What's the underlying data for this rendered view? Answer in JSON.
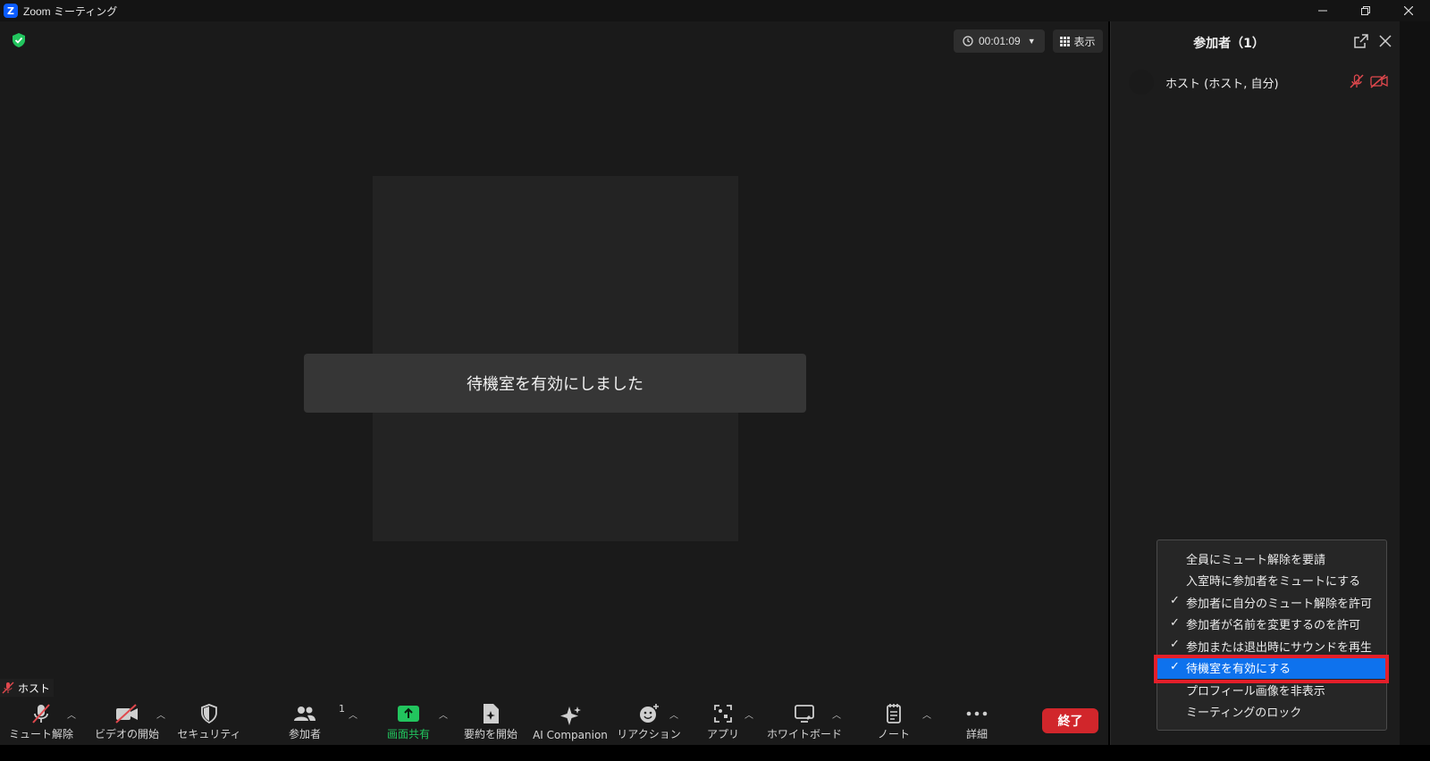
{
  "window": {
    "app_icon_letter": "Z",
    "title": "Zoom ミーティング"
  },
  "meeting": {
    "timer": "00:01:09",
    "view_label": "表示",
    "toast": "待機室を有効にしました",
    "name_tag": "ホスト"
  },
  "toolbar": {
    "items": [
      {
        "label": "ミュート解除",
        "icon": "mic-muted-icon"
      },
      {
        "label": "ビデオの開始",
        "icon": "video-off-icon"
      },
      {
        "label": "セキュリティ",
        "icon": "shield-icon"
      },
      {
        "label": "参加者",
        "icon": "participants-icon",
        "badge": "1"
      },
      {
        "label": "画面共有",
        "icon": "share-screen-icon"
      },
      {
        "label": "要約を開始",
        "icon": "summary-icon"
      },
      {
        "label": "AI Companion",
        "icon": "ai-companion-icon"
      },
      {
        "label": "リアクション",
        "icon": "reaction-icon"
      },
      {
        "label": "アプリ",
        "icon": "apps-icon"
      },
      {
        "label": "ホワイトボード",
        "icon": "whiteboard-icon"
      },
      {
        "label": "ノート",
        "icon": "notes-icon"
      },
      {
        "label": "詳細",
        "icon": "more-icon"
      }
    ],
    "end_label": "終了",
    "share_color": "#22c55e",
    "end_color": "#d1262b"
  },
  "panel": {
    "title": "参加者（1）",
    "participants": [
      {
        "name": "ホスト (ホスト, 自分)",
        "mic": "muted",
        "video": "off"
      }
    ]
  },
  "menu": {
    "items": [
      {
        "label": "全員にミュート解除を要請",
        "checked": false,
        "selected": false
      },
      {
        "label": "入室時に参加者をミュートにする",
        "checked": false,
        "selected": false
      },
      {
        "label": "参加者に自分のミュート解除を許可",
        "checked": true,
        "selected": false
      },
      {
        "label": "参加者が名前を変更するのを許可",
        "checked": true,
        "selected": false
      },
      {
        "label": "参加または退出時にサウンドを再生",
        "checked": true,
        "selected": false
      },
      {
        "label": "待機室を有効にする",
        "checked": true,
        "selected": true
      },
      {
        "label": "プロフィール画像を非表示",
        "checked": false,
        "selected": false
      },
      {
        "label": "ミーティングのロック",
        "checked": false,
        "selected": false
      }
    ],
    "check_glyph": "✓",
    "selected_color": "#0e72ed",
    "highlight_color": "#e41f2a"
  }
}
